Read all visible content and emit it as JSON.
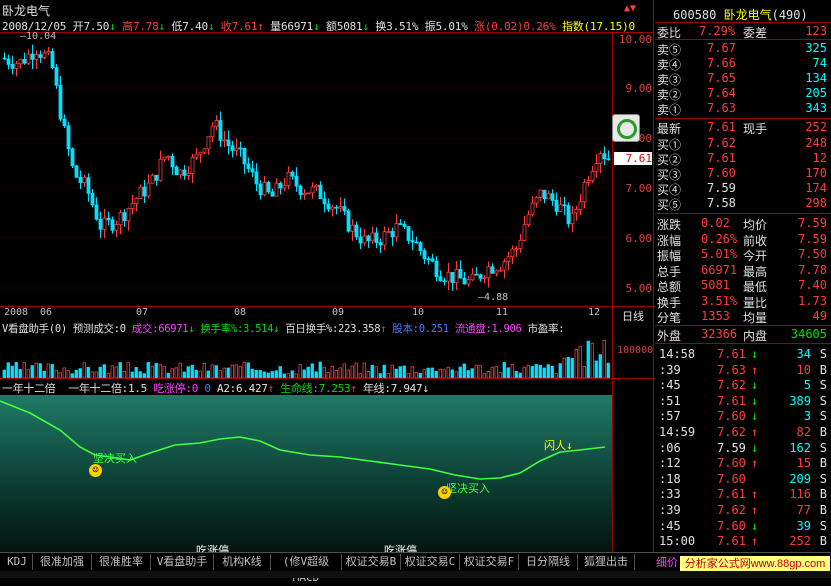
{
  "header": {
    "title": "卧龙电气",
    "nav_icons": "▲▼"
  },
  "info_line": {
    "date": "2008/12/05",
    "open": "开7.50",
    "open_arrow": "↓",
    "high": "高7.78",
    "high_arrow": "↓",
    "low": "低7.40",
    "low_arrow": "↓",
    "close": "收7.61",
    "close_arrow": "↑",
    "volume": "量66971",
    "volume_arrow": "↓",
    "amount": "额5081",
    "amount_arrow": "↓",
    "turnover": "换3.51%",
    "amplitude": "振5.01%",
    "change": "涨(0.02)0.26%",
    "index": "指数(17.15)0"
  },
  "price_chart": {
    "y_ticks": [
      "10.00",
      "9.00",
      "8.00",
      "7.00",
      "6.00",
      "5.00"
    ],
    "high_label": "10.04",
    "low_label": "4.88",
    "current_price_tag": "7.61",
    "dates": [
      "2008",
      "06",
      "07",
      "08",
      "09",
      "10",
      "11",
      "12"
    ],
    "period_label": "日线"
  },
  "volume_panel": {
    "indicator_name": "V看盘助手(0)",
    "forecast_label": "预测成交:0",
    "volume_text": "成交:66971",
    "volume_arrow": "↓",
    "turnover_text": "换手率%:3.514",
    "turnover_arrow": "↓",
    "hundred_day_text": "百日换手%:223.358",
    "hundred_day_arrow": "↑",
    "equity_text": "股本:0.251",
    "float_text": "流通盘:1.906",
    "pe_text": "市盈率:",
    "y_tick": "100000"
  },
  "indicator_panel": {
    "name": "一年十二倍",
    "value_label": "一年十二倍:1.5",
    "limit_label": "吃涨停:0",
    "zero_label": "0",
    "a2_label": "A2:6.427",
    "a2_arrow": "↑",
    "life_label": "生命线:7.253",
    "life_arrow": "↑",
    "year_label": "年线:7.947",
    "year_arrow": "↓",
    "buy1": "坚决买入",
    "buy2": "坚决买入",
    "flash_in": "闪人↓",
    "eat_limit1": "吃涨停",
    "eat_limit2": "吃涨停"
  },
  "quote": {
    "code": "600580",
    "name": "卧龙电气",
    "count": "(490)",
    "weibi_label": "委比",
    "weibi_value": "7.29%",
    "weicha_label": "委差",
    "weicha_value": "123",
    "sells": [
      {
        "label": "卖⑤",
        "price": "7.67",
        "arrow": "",
        "vol": "325"
      },
      {
        "label": "卖④",
        "price": "7.66",
        "arrow": "",
        "vol": "74"
      },
      {
        "label": "卖③",
        "price": "7.65",
        "arrow": "",
        "vol": "134"
      },
      {
        "label": "卖②",
        "price": "7.64",
        "arrow": "",
        "vol": "205"
      },
      {
        "label": "卖①",
        "price": "7.63",
        "arrow": "",
        "vol": "343"
      }
    ],
    "latest_label": "最新",
    "latest_value": "7.61",
    "now_hand_label": "现手",
    "now_hand_value": "252",
    "buys": [
      {
        "label": "买①",
        "price": "7.62",
        "vol": "248"
      },
      {
        "label": "买②",
        "price": "7.61",
        "vol": "12"
      },
      {
        "label": "买③",
        "price": "7.60",
        "vol": "170"
      },
      {
        "label": "买④",
        "price": "7.59",
        "vol": "174"
      },
      {
        "label": "买⑤",
        "price": "7.58",
        "vol": "298"
      }
    ],
    "stats": [
      {
        "l1": "涨跌",
        "v1": "0.02",
        "l2": "均价",
        "v2": "7.59"
      },
      {
        "l1": "涨幅",
        "v1": "0.26%",
        "l2": "前收",
        "v2": "7.59"
      },
      {
        "l1": "振幅",
        "v1": "5.01%",
        "l2": "今开",
        "v2": "7.50"
      },
      {
        "l1": "总手",
        "v1": "66971",
        "l2": "最高",
        "v2": "7.78"
      },
      {
        "l1": "总额",
        "v1": "5081",
        "l2": "最低",
        "v2": "7.40"
      },
      {
        "l1": "换手",
        "v1": "3.51%",
        "l2": "量比",
        "v2": "1.73"
      },
      {
        "l1": "分笔",
        "v1": "1353",
        "l2": "均量",
        "v2": "49"
      }
    ],
    "outer_label": "外盘",
    "outer_value": "32366",
    "inner_label": "内盘",
    "inner_value": "34605"
  },
  "ticks": [
    {
      "time": "14:58",
      "price": "7.61",
      "arrow": "↓",
      "vol": "34",
      "side": "S"
    },
    {
      "time": ":39",
      "price": "7.63",
      "arrow": "↑",
      "vol": "10",
      "side": "B"
    },
    {
      "time": ":45",
      "price": "7.62",
      "arrow": "↓",
      "vol": "5",
      "side": "S"
    },
    {
      "time": ":51",
      "price": "7.61",
      "arrow": "↓",
      "vol": "389",
      "side": "S"
    },
    {
      "time": ":57",
      "price": "7.60",
      "arrow": "↓",
      "vol": "3",
      "side": "S"
    },
    {
      "time": "14:59",
      "price": "7.62",
      "arrow": "↑",
      "vol": "82",
      "side": "B"
    },
    {
      "time": ":06",
      "price": "7.59",
      "arrow": "↓",
      "vol": "162",
      "side": "S"
    },
    {
      "time": ":12",
      "price": "7.60",
      "arrow": "↑",
      "vol": "15",
      "side": "B"
    },
    {
      "time": ":18",
      "price": "7.60",
      "arrow": "",
      "vol": "209",
      "side": "S"
    },
    {
      "time": ":33",
      "price": "7.61",
      "arrow": "↑",
      "vol": "116",
      "side": "B"
    },
    {
      "time": ":39",
      "price": "7.62",
      "arrow": "↑",
      "vol": "77",
      "side": "B"
    },
    {
      "time": ":45",
      "price": "7.60",
      "arrow": "↓",
      "vol": "39",
      "side": "S"
    },
    {
      "time": "15:00",
      "price": "7.61",
      "arrow": "↑",
      "vol": "252",
      "side": "B"
    }
  ],
  "tabs": [
    "KDJ",
    "很准加强",
    "很准胜率",
    "V看盘助手",
    "机构K线",
    "(修V超级MACD",
    "权证交易B",
    "权证交易C",
    "权证交易F",
    "日分隔线",
    "狐狸出击"
  ],
  "detail_tab": "细价",
  "watermark": "分析家公式网www.88gp.com",
  "colors": {
    "up": "#ff3c3c",
    "down": "#00e0ff",
    "volume_line": "#00c000",
    "life_line": "#40ff40",
    "panel_border": "#a00000"
  }
}
